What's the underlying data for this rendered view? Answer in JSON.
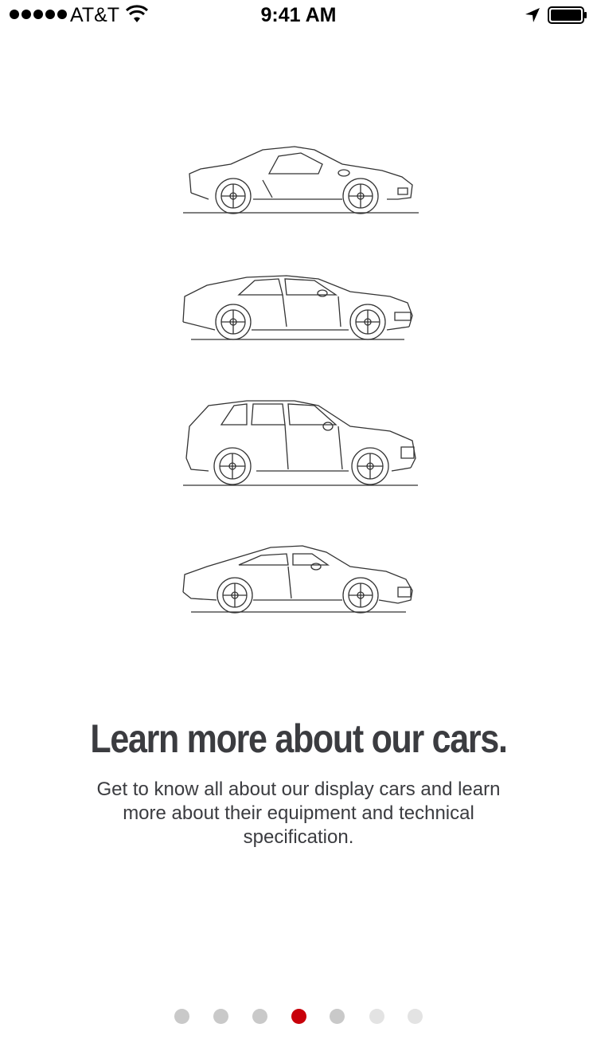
{
  "status_bar": {
    "carrier": "AT&T",
    "time": "9:41 AM",
    "icons": [
      "signal-dots",
      "wifi-icon",
      "location-arrow-icon",
      "battery-icon"
    ]
  },
  "illustrations": [
    {
      "name": "coupe-car-illustration",
      "icon": "sports-coupe-line-drawing"
    },
    {
      "name": "sedan-car-illustration",
      "icon": "four-door-sedan-line-drawing"
    },
    {
      "name": "suv-car-illustration",
      "icon": "suv-line-drawing"
    },
    {
      "name": "sports-car-illustration",
      "icon": "rear-engine-sports-car-line-drawing"
    }
  ],
  "onboarding": {
    "headline": "Learn more about our cars.",
    "body": "Get to know all about our display cars and learn more about their equipment and technical specification."
  },
  "pager": {
    "count": 7,
    "active_index": 3,
    "colors": {
      "active": "#c8000a",
      "inactive": "#c9c9c9",
      "faded": "#e3e3e3"
    }
  }
}
